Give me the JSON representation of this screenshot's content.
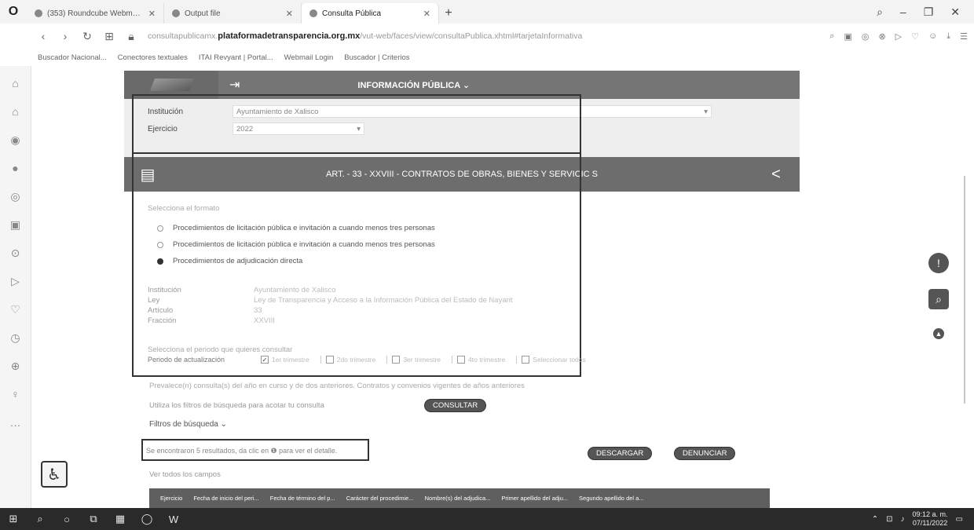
{
  "tabs": [
    {
      "title": "(353) Roundcube Webmail...",
      "active": false
    },
    {
      "title": "Output file",
      "active": false
    },
    {
      "title": "Consulta Pública",
      "active": true
    }
  ],
  "address": {
    "url_prefix": "consultapublicamx.",
    "url_host": "plataformadetransparencia.org.mx",
    "url_path": "/vut-web/faces/view/consultaPublica.xhtml#tarjetaInformativa"
  },
  "bookmarks": [
    "Buscador Nacional...",
    "Conectores textuales",
    "ITAI Revyant | Portal...",
    "Webmail Login",
    "Buscador | Criterios"
  ],
  "banner": {
    "title": "INFORMACIÓN PÚBLICA ⌄"
  },
  "filters": {
    "institution_label": "Institución",
    "institution_value": "Ayuntamiento de Xalisco",
    "year_label": "Ejercicio",
    "year_value": "2022"
  },
  "article": {
    "title": "ART. - 33 - XXVIII - CONTRATOS DE OBRAS, BIENES Y SERVICIC S"
  },
  "format": {
    "prompt": "Selecciona el formato",
    "options": [
      {
        "label": "Procedimientos de licitación pública e invitación a cuando menos tres personas",
        "selected": false
      },
      {
        "label": "Procedimientos de licitación pública e invitación a cuando menos tres personas",
        "selected": false
      },
      {
        "label": "Procedimientos de adjudicación directa",
        "selected": true
      }
    ]
  },
  "info": [
    {
      "k": "Institución",
      "v": "Ayuntamiento de Xalisco"
    },
    {
      "k": "Ley",
      "v": "Ley de Transparencia y Acceso a la Información Pública del Estado de Nayarit"
    },
    {
      "k": "Artículo",
      "v": "33"
    },
    {
      "k": "Fracción",
      "v": "XXVIII"
    }
  ],
  "period": {
    "prompt": "Selecciona el periodo que quieres consultar",
    "label": "Periodo de actualización",
    "options": [
      "1er trimestre",
      "2do trimestre",
      "3er trimestre",
      "4to trimestre",
      "Seleccionar todos"
    ]
  },
  "notes": {
    "archive": "Prevalece(n) consulta(s) del año en curso y de dos anteriores. Contratos y convenios vigentes de años anteriores",
    "filters_hint": "Utiliza los filtros de búsqueda para acotar tu consulta",
    "consult_btn": "CONSULTAR",
    "filters_toggle": "Filtros de búsqueda ⌄",
    "results": "Se encontraron 5 resultados, da clic en ❶ para ver el detalle.",
    "download_btn": "DESCARGAR",
    "report_btn": "DENUNCIAR",
    "all_fields": "Ver todos los campos"
  },
  "table_headers": [
    "Ejercicio",
    "Fecha de inicio del peri...",
    "Fecha de término del p...",
    "Carácter del procedimie...",
    "Nombre(s) del adjudica...",
    "Primer apellido del adju...",
    "Segundo apellido del a..."
  ],
  "clock": {
    "time": "09:12 a. m.",
    "date": "07/11/2022"
  }
}
